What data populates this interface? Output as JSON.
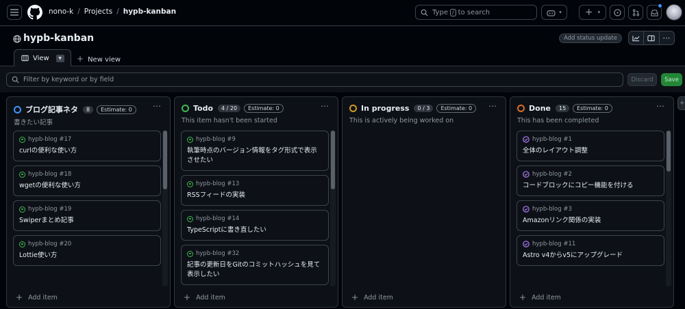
{
  "header": {
    "owner": "nono-k",
    "projects": "Projects",
    "project": "hypb-kanban",
    "search_prefix": "Type",
    "search_key": "/",
    "search_suffix": "to search"
  },
  "project": {
    "title": "hypb-kanban",
    "status_update": "Add status update",
    "tab_label": "View",
    "new_view": "New view"
  },
  "filter": {
    "placeholder": "Filter by keyword or by field",
    "discard": "Discard",
    "save": "Save"
  },
  "colors": {
    "blue": "#4493f8",
    "green": "#3fb950",
    "yellow": "#d29922",
    "orange": "#db6d28",
    "purple": "#ab7df8"
  },
  "columns": [
    {
      "name": "ブログ記事ネタ",
      "count": "8",
      "estimate": "Estimate: 0",
      "description": "書きたい記事",
      "color": "#4493f8",
      "add_item": "Add item",
      "cards": [
        {
          "ref": "hypb-blog #17",
          "title": "curlの便利な使い方",
          "state": "open"
        },
        {
          "ref": "hypb-blog #18",
          "title": "wgetの便利な使い方",
          "state": "open"
        },
        {
          "ref": "hypb-blog #19",
          "title": "Swiperまとめ記事",
          "state": "open"
        },
        {
          "ref": "hypb-blog #20",
          "title": "Lottie使い方",
          "state": "open"
        }
      ]
    },
    {
      "name": "Todo",
      "count": "4 / 20",
      "estimate": "Estimate: 0",
      "description": "This item hasn't been started",
      "color": "#3fb950",
      "add_item": "Add item",
      "cards": [
        {
          "ref": "hypb-blog #9",
          "title": "執筆時点のバージョン情報をタグ形式で表示させたい",
          "state": "open"
        },
        {
          "ref": "hypb-blog #13",
          "title": "RSSフィードの実装",
          "state": "open"
        },
        {
          "ref": "hypb-blog #14",
          "title": "TypeScriptに書き直したい",
          "state": "open"
        },
        {
          "ref": "hypb-blog #32",
          "title": "記事の更新日をGitのコミットハッシュを見て表示したい",
          "state": "open"
        }
      ]
    },
    {
      "name": "In progress",
      "count": "0 / 3",
      "estimate": "Estimate: 0",
      "description": "This is actively being worked on",
      "color": "#d29922",
      "add_item": "Add item",
      "cards": []
    },
    {
      "name": "Done",
      "count": "15",
      "estimate": "Estimate: 0",
      "description": "This has been completed",
      "color": "#db6d28",
      "add_item": "Add item",
      "cards": [
        {
          "ref": "hypb-blog #1",
          "title": "全体のレイアウト調整",
          "state": "done"
        },
        {
          "ref": "hypb-blog #2",
          "title": "コードブロックにコピー機能を付ける",
          "state": "done"
        },
        {
          "ref": "hypb-blog #3",
          "title": "Amazonリンク関係の実装",
          "state": "done"
        },
        {
          "ref": "hypb-blog #11",
          "title": "Astro v4からv5にアップグレード",
          "state": "done"
        }
      ]
    }
  ]
}
